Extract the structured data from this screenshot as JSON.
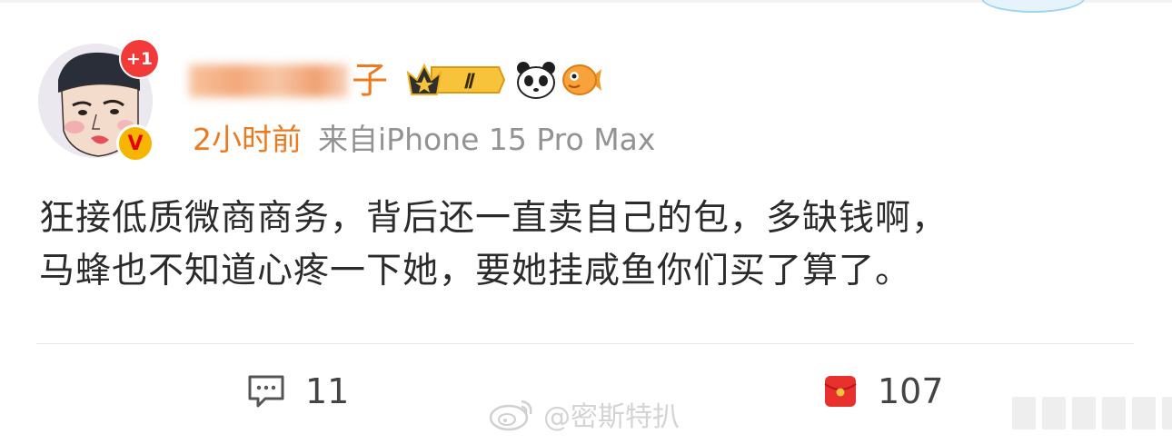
{
  "post": {
    "notification_badge": "+1",
    "author_name_visible_suffix": "子",
    "vip_level": "Ⅱ",
    "time": "2小时前",
    "source": "来自iPhone 15 Pro Max",
    "content_lines": [
      "狂接低质微商商务，背后还一直卖自己的包，多缺钱啊，",
      "马蜂也不知道心疼一下她，要她挂咸鱼你们买了算了。"
    ]
  },
  "actions": {
    "comments_count": "11",
    "likes_count": "107"
  },
  "watermark": "@密斯特扒",
  "icons": {
    "avatar": "cartoon-avatar",
    "verified": "verified-badge-icon",
    "vip": "vip-crown-icon",
    "panda": "panda-icon",
    "fish": "fish-icon",
    "comment": "comment-icon",
    "like": "red-envelope-icon",
    "weibo": "weibo-logo-icon"
  },
  "colors": {
    "username": "#ef7a1e",
    "badge": "#f33a3a",
    "like_icon": "#e8302c"
  }
}
